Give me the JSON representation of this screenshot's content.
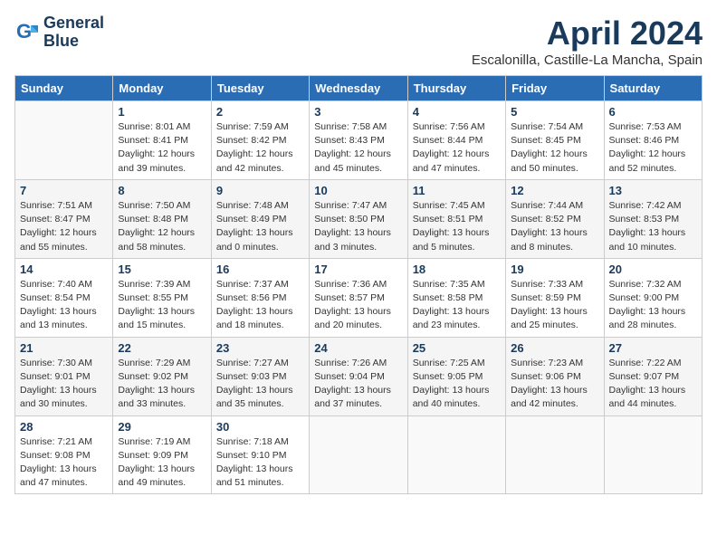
{
  "header": {
    "logo_line1": "General",
    "logo_line2": "Blue",
    "month_year": "April 2024",
    "location": "Escalonilla, Castille-La Mancha, Spain"
  },
  "weekdays": [
    "Sunday",
    "Monday",
    "Tuesday",
    "Wednesday",
    "Thursday",
    "Friday",
    "Saturday"
  ],
  "weeks": [
    [
      {
        "day": "",
        "info": ""
      },
      {
        "day": "1",
        "info": "Sunrise: 8:01 AM\nSunset: 8:41 PM\nDaylight: 12 hours\nand 39 minutes."
      },
      {
        "day": "2",
        "info": "Sunrise: 7:59 AM\nSunset: 8:42 PM\nDaylight: 12 hours\nand 42 minutes."
      },
      {
        "day": "3",
        "info": "Sunrise: 7:58 AM\nSunset: 8:43 PM\nDaylight: 12 hours\nand 45 minutes."
      },
      {
        "day": "4",
        "info": "Sunrise: 7:56 AM\nSunset: 8:44 PM\nDaylight: 12 hours\nand 47 minutes."
      },
      {
        "day": "5",
        "info": "Sunrise: 7:54 AM\nSunset: 8:45 PM\nDaylight: 12 hours\nand 50 minutes."
      },
      {
        "day": "6",
        "info": "Sunrise: 7:53 AM\nSunset: 8:46 PM\nDaylight: 12 hours\nand 52 minutes."
      }
    ],
    [
      {
        "day": "7",
        "info": "Sunrise: 7:51 AM\nSunset: 8:47 PM\nDaylight: 12 hours\nand 55 minutes."
      },
      {
        "day": "8",
        "info": "Sunrise: 7:50 AM\nSunset: 8:48 PM\nDaylight: 12 hours\nand 58 minutes."
      },
      {
        "day": "9",
        "info": "Sunrise: 7:48 AM\nSunset: 8:49 PM\nDaylight: 13 hours\nand 0 minutes."
      },
      {
        "day": "10",
        "info": "Sunrise: 7:47 AM\nSunset: 8:50 PM\nDaylight: 13 hours\nand 3 minutes."
      },
      {
        "day": "11",
        "info": "Sunrise: 7:45 AM\nSunset: 8:51 PM\nDaylight: 13 hours\nand 5 minutes."
      },
      {
        "day": "12",
        "info": "Sunrise: 7:44 AM\nSunset: 8:52 PM\nDaylight: 13 hours\nand 8 minutes."
      },
      {
        "day": "13",
        "info": "Sunrise: 7:42 AM\nSunset: 8:53 PM\nDaylight: 13 hours\nand 10 minutes."
      }
    ],
    [
      {
        "day": "14",
        "info": "Sunrise: 7:40 AM\nSunset: 8:54 PM\nDaylight: 13 hours\nand 13 minutes."
      },
      {
        "day": "15",
        "info": "Sunrise: 7:39 AM\nSunset: 8:55 PM\nDaylight: 13 hours\nand 15 minutes."
      },
      {
        "day": "16",
        "info": "Sunrise: 7:37 AM\nSunset: 8:56 PM\nDaylight: 13 hours\nand 18 minutes."
      },
      {
        "day": "17",
        "info": "Sunrise: 7:36 AM\nSunset: 8:57 PM\nDaylight: 13 hours\nand 20 minutes."
      },
      {
        "day": "18",
        "info": "Sunrise: 7:35 AM\nSunset: 8:58 PM\nDaylight: 13 hours\nand 23 minutes."
      },
      {
        "day": "19",
        "info": "Sunrise: 7:33 AM\nSunset: 8:59 PM\nDaylight: 13 hours\nand 25 minutes."
      },
      {
        "day": "20",
        "info": "Sunrise: 7:32 AM\nSunset: 9:00 PM\nDaylight: 13 hours\nand 28 minutes."
      }
    ],
    [
      {
        "day": "21",
        "info": "Sunrise: 7:30 AM\nSunset: 9:01 PM\nDaylight: 13 hours\nand 30 minutes."
      },
      {
        "day": "22",
        "info": "Sunrise: 7:29 AM\nSunset: 9:02 PM\nDaylight: 13 hours\nand 33 minutes."
      },
      {
        "day": "23",
        "info": "Sunrise: 7:27 AM\nSunset: 9:03 PM\nDaylight: 13 hours\nand 35 minutes."
      },
      {
        "day": "24",
        "info": "Sunrise: 7:26 AM\nSunset: 9:04 PM\nDaylight: 13 hours\nand 37 minutes."
      },
      {
        "day": "25",
        "info": "Sunrise: 7:25 AM\nSunset: 9:05 PM\nDaylight: 13 hours\nand 40 minutes."
      },
      {
        "day": "26",
        "info": "Sunrise: 7:23 AM\nSunset: 9:06 PM\nDaylight: 13 hours\nand 42 minutes."
      },
      {
        "day": "27",
        "info": "Sunrise: 7:22 AM\nSunset: 9:07 PM\nDaylight: 13 hours\nand 44 minutes."
      }
    ],
    [
      {
        "day": "28",
        "info": "Sunrise: 7:21 AM\nSunset: 9:08 PM\nDaylight: 13 hours\nand 47 minutes."
      },
      {
        "day": "29",
        "info": "Sunrise: 7:19 AM\nSunset: 9:09 PM\nDaylight: 13 hours\nand 49 minutes."
      },
      {
        "day": "30",
        "info": "Sunrise: 7:18 AM\nSunset: 9:10 PM\nDaylight: 13 hours\nand 51 minutes."
      },
      {
        "day": "",
        "info": ""
      },
      {
        "day": "",
        "info": ""
      },
      {
        "day": "",
        "info": ""
      },
      {
        "day": "",
        "info": ""
      }
    ]
  ]
}
